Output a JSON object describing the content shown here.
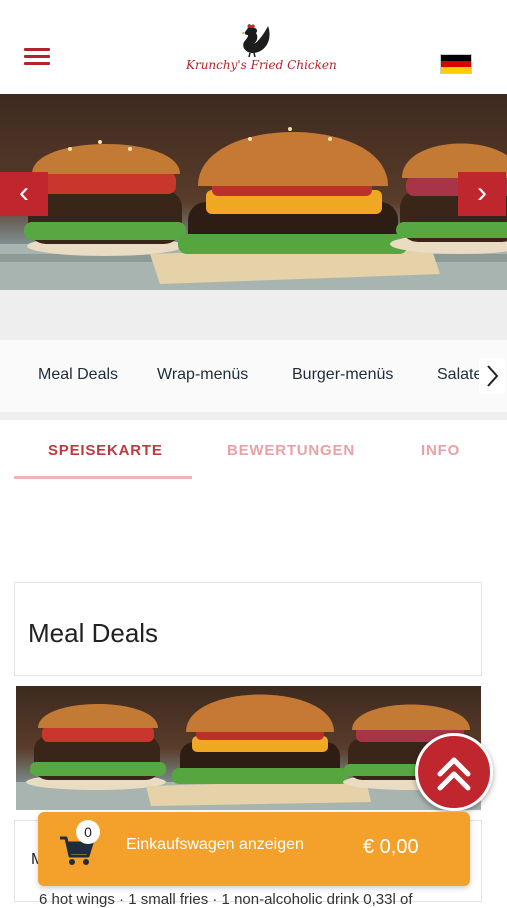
{
  "header": {
    "menu_icon": "hamburger-menu-icon",
    "logo_text": "Krunchy's Fried Chicken",
    "logo_icon": "rooster-icon",
    "language_flag": "german-flag-icon"
  },
  "hero": {
    "prev_label": "‹",
    "next_label": "›"
  },
  "categories": [
    {
      "label": "Meal Deals"
    },
    {
      "label": "Wrap-menüs"
    },
    {
      "label": "Burger-menüs"
    },
    {
      "label": "Salate"
    }
  ],
  "category_next_icon": "chevron-right-icon",
  "tabs": [
    {
      "label": "SPEISEKARTE",
      "active": true
    },
    {
      "label": "BEWERTUNGEN",
      "active": false
    },
    {
      "label": "INFO",
      "active": false
    }
  ],
  "section": {
    "title": "Meal Deals"
  },
  "first_item": {
    "title_partial": "M",
    "description_partial": "6 hot wings · 1 small fries · 1 non-alcoholic drink 0,33l of"
  },
  "cart": {
    "count": "0",
    "label": "Einkaufswagen anzeigen",
    "total": "€ 0,00",
    "icon": "shopping-cart-icon"
  },
  "scroll_top_icon": "double-chevron-up-icon",
  "colors": {
    "brand_red": "#c0262e",
    "tab_active": "#c0393f",
    "tab_inactive": "#eaa1a5",
    "cart_orange": "#f4a12c"
  }
}
